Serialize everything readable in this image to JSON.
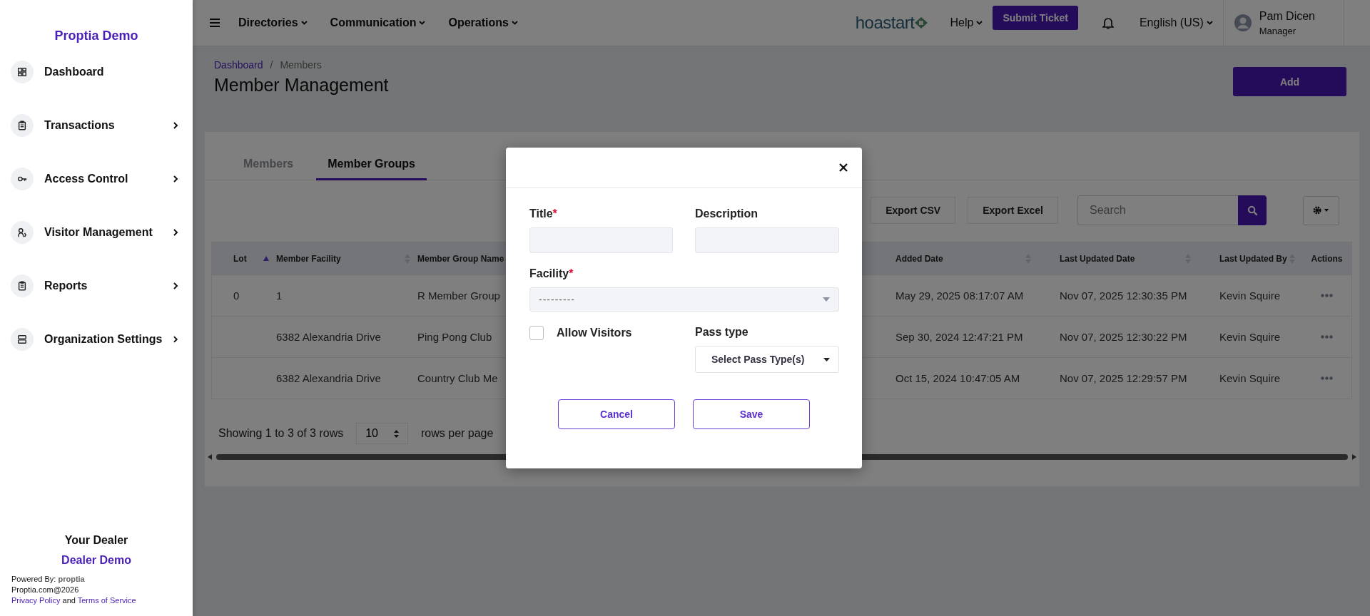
{
  "sidebar": {
    "title": "Proptia Demo",
    "items": [
      {
        "label": "Dashboard",
        "has_submenu": false
      },
      {
        "label": "Transactions",
        "has_submenu": true
      },
      {
        "label": "Access Control",
        "has_submenu": true
      },
      {
        "label": "Visitor Management",
        "has_submenu": true
      },
      {
        "label": "Reports",
        "has_submenu": true
      },
      {
        "label": "Organization Settings",
        "has_submenu": true
      }
    ],
    "dealer_heading": "Your Dealer",
    "dealer_name": "Dealer Demo",
    "powered_by": "Powered By:",
    "powered_brand": "proptia",
    "copyright": "Proptia.com@2026",
    "legal": [
      {
        "kind": "link",
        "text": "Privacy Policy"
      },
      {
        "kind": "text",
        "text": "and"
      },
      {
        "kind": "link",
        "text": "Terms of Service"
      }
    ]
  },
  "top_bar": {
    "menus": [
      "Directories",
      "Communication",
      "Operations"
    ],
    "logo": "hoastart",
    "help": "Help",
    "submit_ticket": "Submit Ticket",
    "language": "English (US)",
    "user_name": "Pam Dicen",
    "user_role": "Manager"
  },
  "breadcrumb": {
    "separator": "/",
    "items": [
      {
        "label": "Dashboard",
        "link": true
      },
      {
        "label": "Members",
        "link": false
      }
    ]
  },
  "page_title": "Member Management",
  "add_button": "Add",
  "tabs": [
    {
      "label": "Members",
      "selected": false
    },
    {
      "label": "Member Groups",
      "selected": true
    }
  ],
  "toolbar": {
    "export_csv": "Export CSV",
    "export_excel": "Export Excel",
    "search": {
      "placeholder": "Search"
    }
  },
  "table": {
    "columns": [
      {
        "label": "Lot",
        "sortable": true,
        "sorted": true
      },
      {
        "label": "Member Facility",
        "sortable": true,
        "sorted": false
      },
      {
        "label": "Member Group Name",
        "sortable": false
      },
      {
        "label": "Added Date",
        "sortable": true,
        "sorted": false
      },
      {
        "label": "Last Updated Date",
        "sortable": true,
        "sorted": false
      },
      {
        "label": "Last Updated By",
        "sortable": true,
        "sorted": false
      },
      {
        "label": "Actions",
        "sortable": false
      }
    ],
    "rows": [
      [
        "0",
        "1",
        "R Member Group",
        "May 29, 2025 08:17:07 AM",
        "Nov 07, 2025 12:30:35 PM",
        "Kevin Squire"
      ],
      [
        "",
        "6382 Alexandria Drive",
        "Ping Pong Club",
        "Sep 30, 2024 12:47:21 PM",
        "Nov 07, 2025 12:30:22 PM",
        "Kevin Squire"
      ],
      [
        "",
        "6382 Alexandria Drive",
        "Country Club Me",
        "Oct 15, 2024 10:47:05 AM",
        "Nov 07, 2025 12:29:57 PM",
        "Kevin Squire"
      ]
    ]
  },
  "pagination": {
    "summary": "Showing 1 to 3 of 3 rows",
    "page_size": "10",
    "suffix": "rows per page"
  },
  "modal": {
    "required_mark": "*",
    "fields": [
      {
        "kind": "text",
        "label": "Title",
        "required": true
      },
      {
        "kind": "text",
        "label": "Description",
        "required": false
      },
      {
        "kind": "select",
        "label": "Facility",
        "required": true,
        "value": "---------"
      }
    ],
    "allow_visitors": {
      "label": "Allow Visitors",
      "checked": false
    },
    "pass_type": {
      "label": "Pass type",
      "value": "Select Pass Type(s)"
    },
    "buttons": [
      "Cancel",
      "Save"
    ]
  }
}
